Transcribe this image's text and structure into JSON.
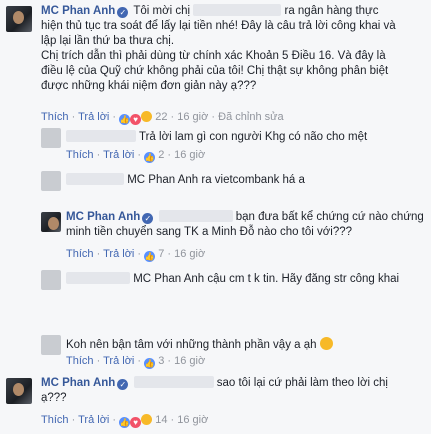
{
  "comments": [
    {
      "name": "MC Phan Anh",
      "line1_a": "Tôi mời chị",
      "line1_b": "ra ngân hàng thực",
      "lines": [
        "hiện thủ tục tra soát để lấy lại tiền nhé! Đây là câu trả lời công khai và",
        "lập lại lần thứ ba thưa chị.",
        "Chị trích dẫn thì phải dùng từ chính xác Khoản 5 Điều 16. Và đây là",
        "điều lệ của Quỹ chứ không phải của tôi! Chị thật sự không phân biệt",
        "được những khái niệm đơn giản này ạ???"
      ],
      "like": "Thích",
      "reply": "Trả lời",
      "reactions": "22",
      "time": "16 giờ",
      "edited": "Đã chỉnh sửa"
    },
    {
      "text": "Trả lời lam gì con người Khg có não cho mệt",
      "like": "Thích",
      "reply": "Trả lời",
      "reactions": "2",
      "time": "16 giờ"
    },
    {
      "text": "MC Phan Anh ra vietcombank há a"
    },
    {
      "name": "MC Phan Anh",
      "line1_b": "bạn đưa bất kể chứng cứ nào chứng",
      "lines": [
        "minh tiền chuyển sang TK a Minh Đỗ nào cho tôi với???"
      ],
      "like": "Thích",
      "reply": "Trả lời",
      "reactions": "7",
      "time": "16 giờ"
    },
    {
      "text": "MC Phan Anh cậu cm t k tin. Hãy đăng str công khai"
    },
    {
      "text": "Koh nên bận tâm với những thành phần vậy a ạh",
      "like": "Thích",
      "reply": "Trả lời",
      "reactions": "3",
      "time": "16 giờ"
    },
    {
      "name": "MC Phan Anh",
      "line1_b": "sao tôi lại cứ phải làm theo lời chị",
      "lines": [
        "ạ???"
      ],
      "like": "Thích",
      "reply": "Trả lời",
      "reactions": "14",
      "time": "16 giờ"
    }
  ],
  "sep": "·",
  "colors": {
    "link": "#365899",
    "meta": "#90949c",
    "action": "#4267b2"
  }
}
